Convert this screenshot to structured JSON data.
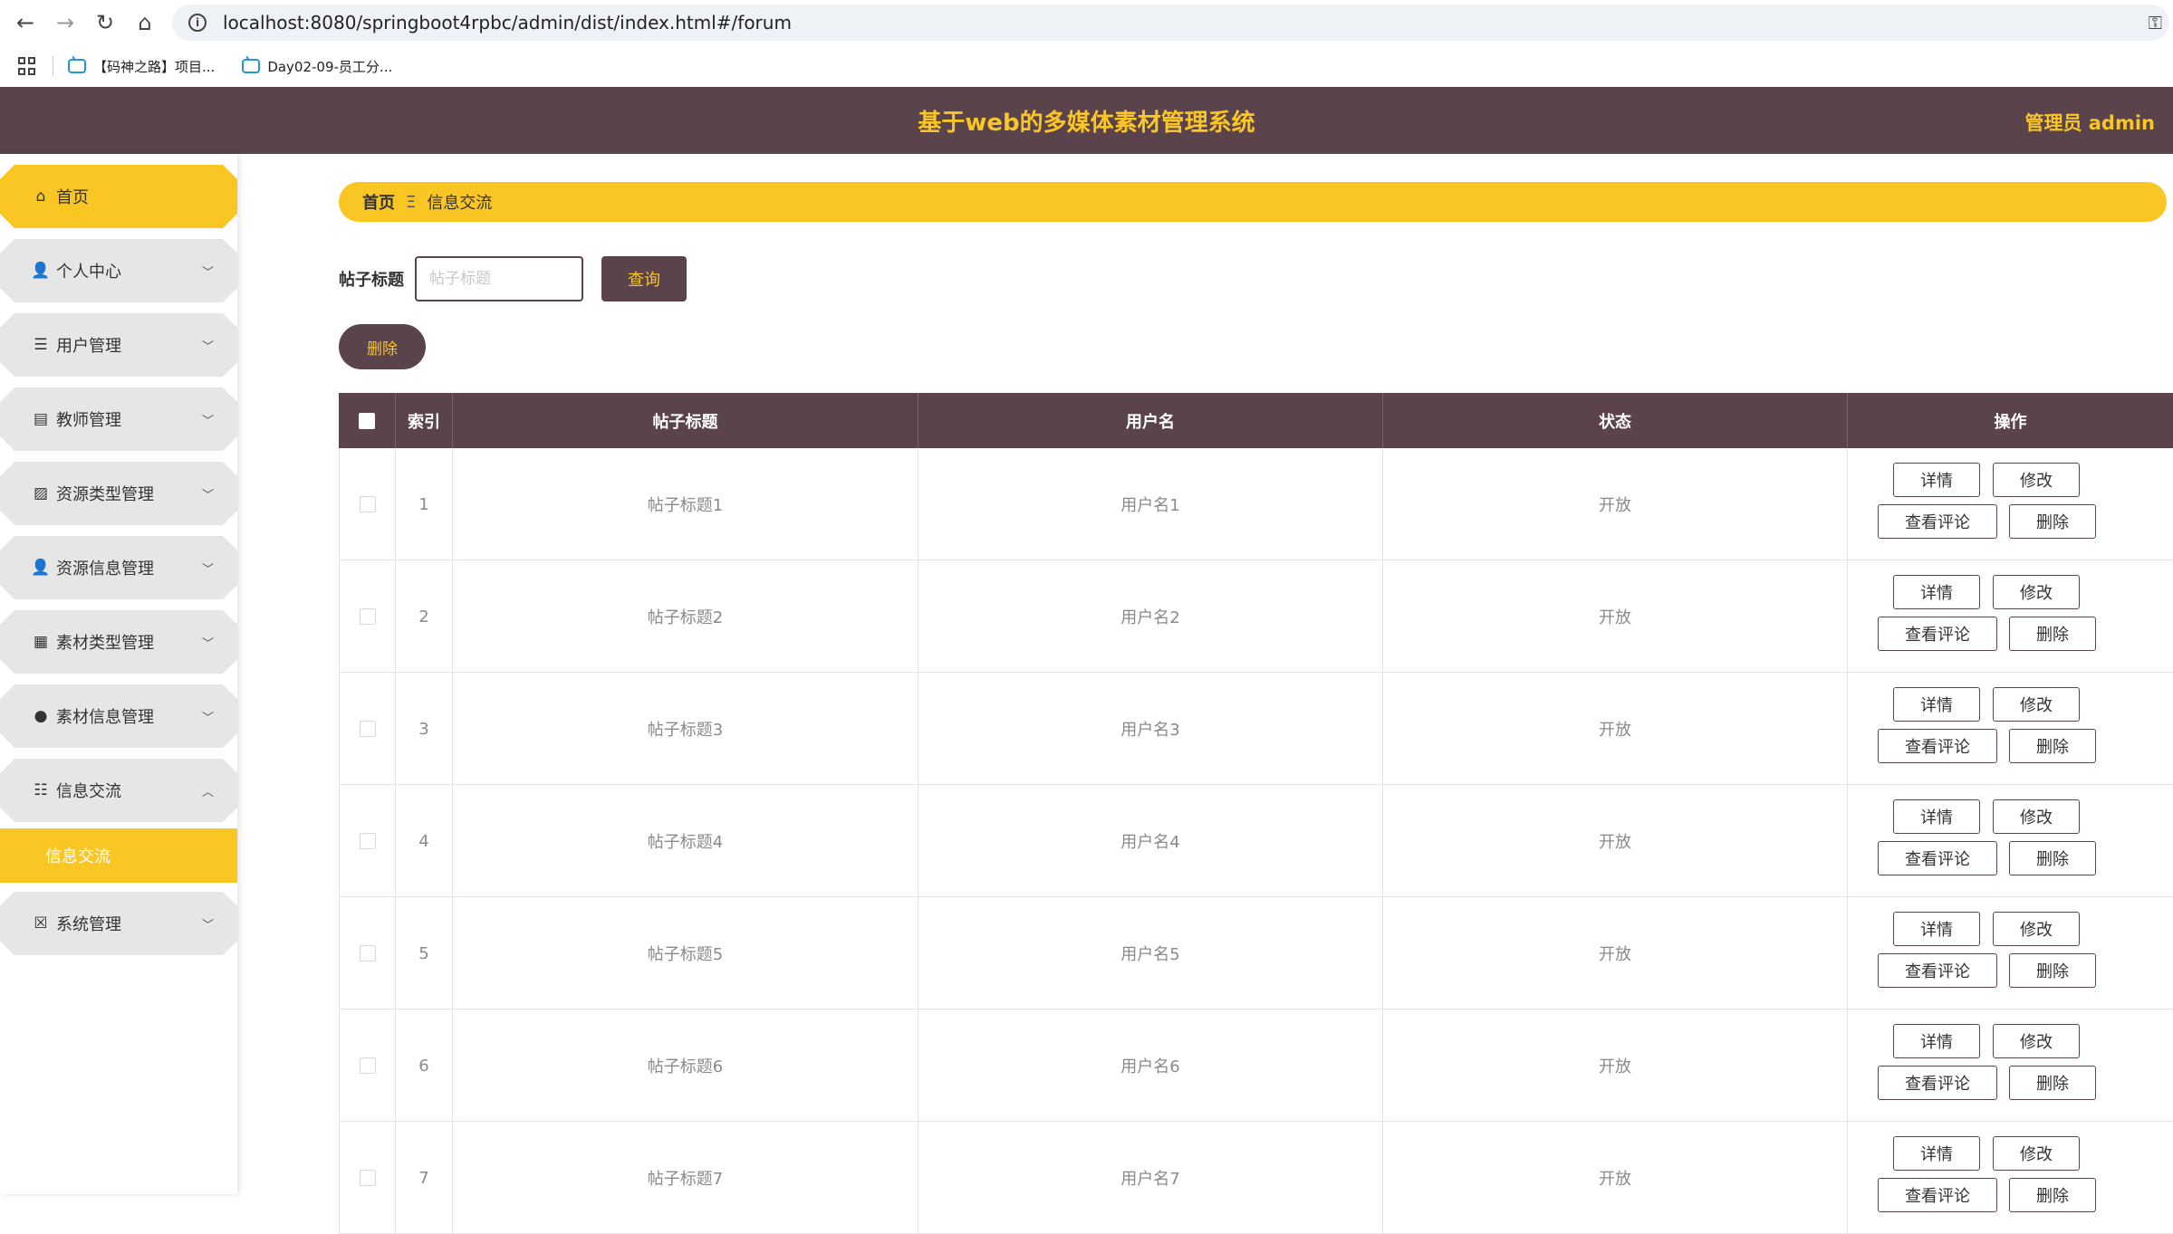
{
  "browser": {
    "url": "localhost:8080/springboot4rpbc/admin/dist/index.html#/forum",
    "bookmarks": [
      "【码神之路】项目...",
      "Day02-09-员工分..."
    ]
  },
  "header": {
    "title": "基于web的多媒体素材管理系统",
    "user": "管理员 admin"
  },
  "sidebar": {
    "items": [
      {
        "label": "首页",
        "icon": "home-icon"
      },
      {
        "label": "个人中心",
        "icon": "user-icon"
      },
      {
        "label": "用户管理",
        "icon": "list-icon"
      },
      {
        "label": "教师管理",
        "icon": "clipboard-icon"
      },
      {
        "label": "资源类型管理",
        "icon": "chart-icon"
      },
      {
        "label": "资源信息管理",
        "icon": "user-icon"
      },
      {
        "label": "素材类型管理",
        "icon": "grid-icon"
      },
      {
        "label": "素材信息管理",
        "icon": "bulb-icon"
      },
      {
        "label": "信息交流",
        "icon": "sliders-icon"
      },
      {
        "label": "系统管理",
        "icon": "clipboard-check-icon"
      }
    ],
    "submenu": {
      "label": "信息交流"
    }
  },
  "breadcrumb": {
    "home": "首页",
    "separator": "Ξ",
    "current": "信息交流"
  },
  "search": {
    "label": "帖子标题",
    "placeholder": "帖子标题",
    "query_label": "查询"
  },
  "toolbar": {
    "delete_label": "删除"
  },
  "table": {
    "headers": [
      "索引",
      "帖子标题",
      "用户名",
      "状态",
      "操作"
    ],
    "rows": [
      {
        "index": "1",
        "title": "帖子标题1",
        "user": "用户名1",
        "status": "开放"
      },
      {
        "index": "2",
        "title": "帖子标题2",
        "user": "用户名2",
        "status": "开放"
      },
      {
        "index": "3",
        "title": "帖子标题3",
        "user": "用户名3",
        "status": "开放"
      },
      {
        "index": "4",
        "title": "帖子标题4",
        "user": "用户名4",
        "status": "开放"
      },
      {
        "index": "5",
        "title": "帖子标题5",
        "user": "用户名5",
        "status": "开放"
      },
      {
        "index": "6",
        "title": "帖子标题6",
        "user": "用户名6",
        "status": "开放"
      },
      {
        "index": "7",
        "title": "帖子标题7",
        "user": "用户名7",
        "status": "开放"
      }
    ],
    "actions": {
      "detail": "详情",
      "edit": "修改",
      "comments": "查看评论",
      "delete": "删除"
    }
  },
  "colors": {
    "primary": "#5b434b",
    "accent": "#f9c623"
  }
}
